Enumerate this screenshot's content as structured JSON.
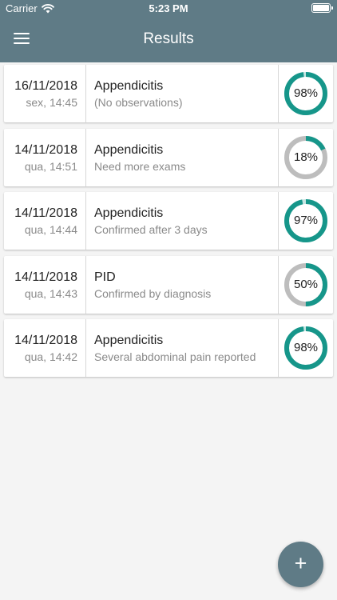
{
  "status_bar": {
    "carrier": "Carrier",
    "time": "5:23 PM"
  },
  "header": {
    "title": "Results"
  },
  "colors": {
    "header": "#5f7b86",
    "gauge_high": "#16968a",
    "gauge_low": "#bdbdbd"
  },
  "results": [
    {
      "date": "16/11/2018",
      "time": "sex, 14:45",
      "diagnosis": "Appendicitis",
      "note": "(No observations)",
      "probability": "98%",
      "value": 0.98
    },
    {
      "date": "14/11/2018",
      "time": "qua, 14:51",
      "diagnosis": "Appendicitis",
      "note": "Need more exams",
      "probability": "18%",
      "value": 0.18
    },
    {
      "date": "14/11/2018",
      "time": "qua, 14:44",
      "diagnosis": "Appendicitis",
      "note": "Confirmed after 3 days",
      "probability": "97%",
      "value": 0.97
    },
    {
      "date": "14/11/2018",
      "time": "qua, 14:43",
      "diagnosis": "PID",
      "note": "Confirmed by diagnosis",
      "probability": "50%",
      "value": 0.5
    },
    {
      "date": "14/11/2018",
      "time": "qua, 14:42",
      "diagnosis": "Appendicitis",
      "note": "Several abdominal pain reported",
      "probability": "98%",
      "value": 0.98
    }
  ],
  "fab": {
    "icon": "plus-icon",
    "label": "+"
  }
}
